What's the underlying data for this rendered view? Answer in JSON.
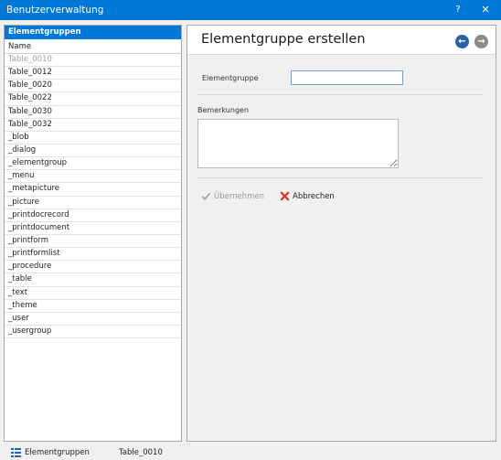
{
  "window": {
    "title": "Benutzerverwaltung",
    "help_label": "?",
    "close_label": "✕"
  },
  "left": {
    "header": "Elementgruppen",
    "column": "Name",
    "items": [
      "Table_0010",
      "Table_0012",
      "Table_0020",
      "Table_0022",
      "Table_0030",
      "Table_0032",
      "_blob",
      "_dialog",
      "_elementgroup",
      "_menu",
      "_metapicture",
      "_picture",
      "_printdocrecord",
      "_printdocument",
      "_printform",
      "_printformlist",
      "_procedure",
      "_table",
      "_text",
      "_theme",
      "_user",
      "_usergroup"
    ],
    "disabled_item": "Table_0010"
  },
  "right": {
    "title": "Elementgruppe erstellen",
    "back_icon": "arrow-left-icon",
    "forward_icon": "arrow-right-icon",
    "field_label": "Elementgruppe",
    "field_value": "",
    "notes_label": "Bemerkungen",
    "notes_value": "",
    "apply_label": "Übernehmen",
    "cancel_label": "Abbrechen"
  },
  "status": {
    "section": "Elementgruppen",
    "selection": "Table_0010"
  },
  "colors": {
    "accent": "#0078d7",
    "cancel": "#d9342b"
  }
}
